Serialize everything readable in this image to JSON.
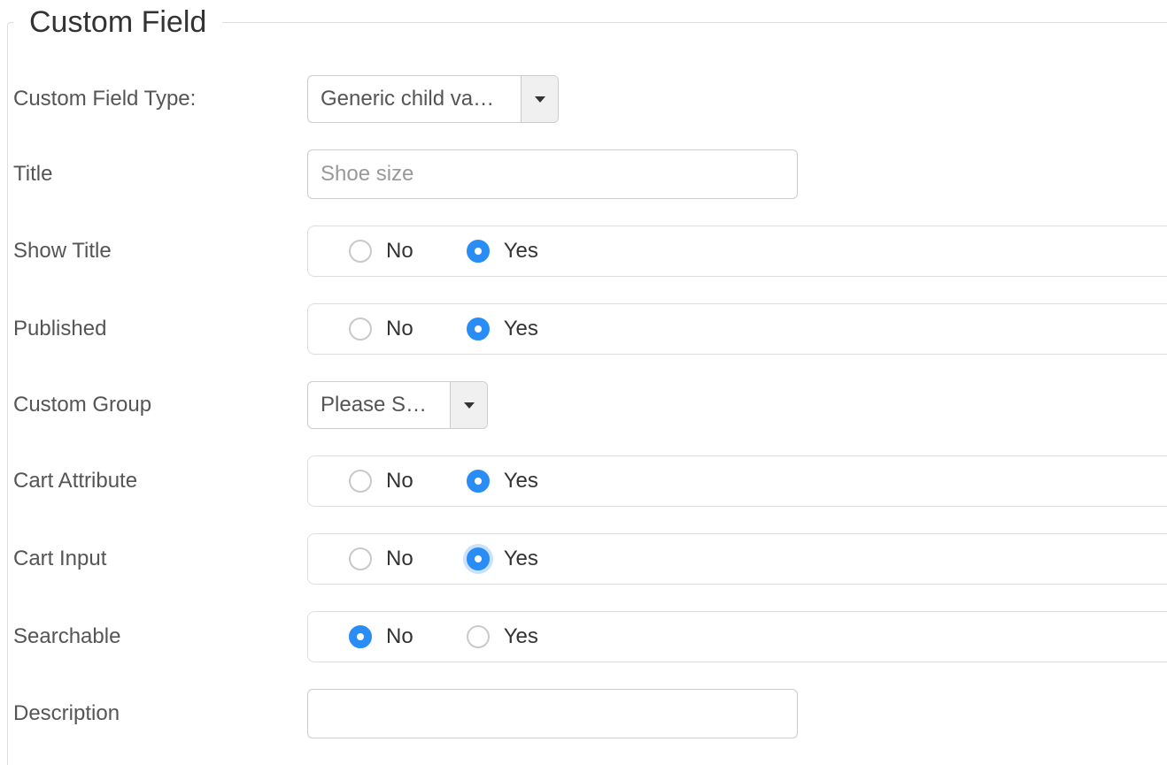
{
  "fieldset": {
    "legend": "Custom Field"
  },
  "options": {
    "no": "No",
    "yes": "Yes"
  },
  "fields": {
    "type": {
      "label": "Custom Field Type:",
      "value": "Generic child va…"
    },
    "title": {
      "label": "Title",
      "value": "Shoe size"
    },
    "show_title": {
      "label": "Show Title",
      "selected": "yes"
    },
    "published": {
      "label": "Published",
      "selected": "yes"
    },
    "custom_group": {
      "label": "Custom Group",
      "value": "Please S…"
    },
    "cart_attribute": {
      "label": "Cart Attribute",
      "selected": "yes"
    },
    "cart_input": {
      "label": "Cart Input",
      "selected": "yes",
      "glow": true
    },
    "searchable": {
      "label": "Searchable",
      "selected": "no"
    },
    "description": {
      "label": "Description",
      "value": ""
    }
  }
}
